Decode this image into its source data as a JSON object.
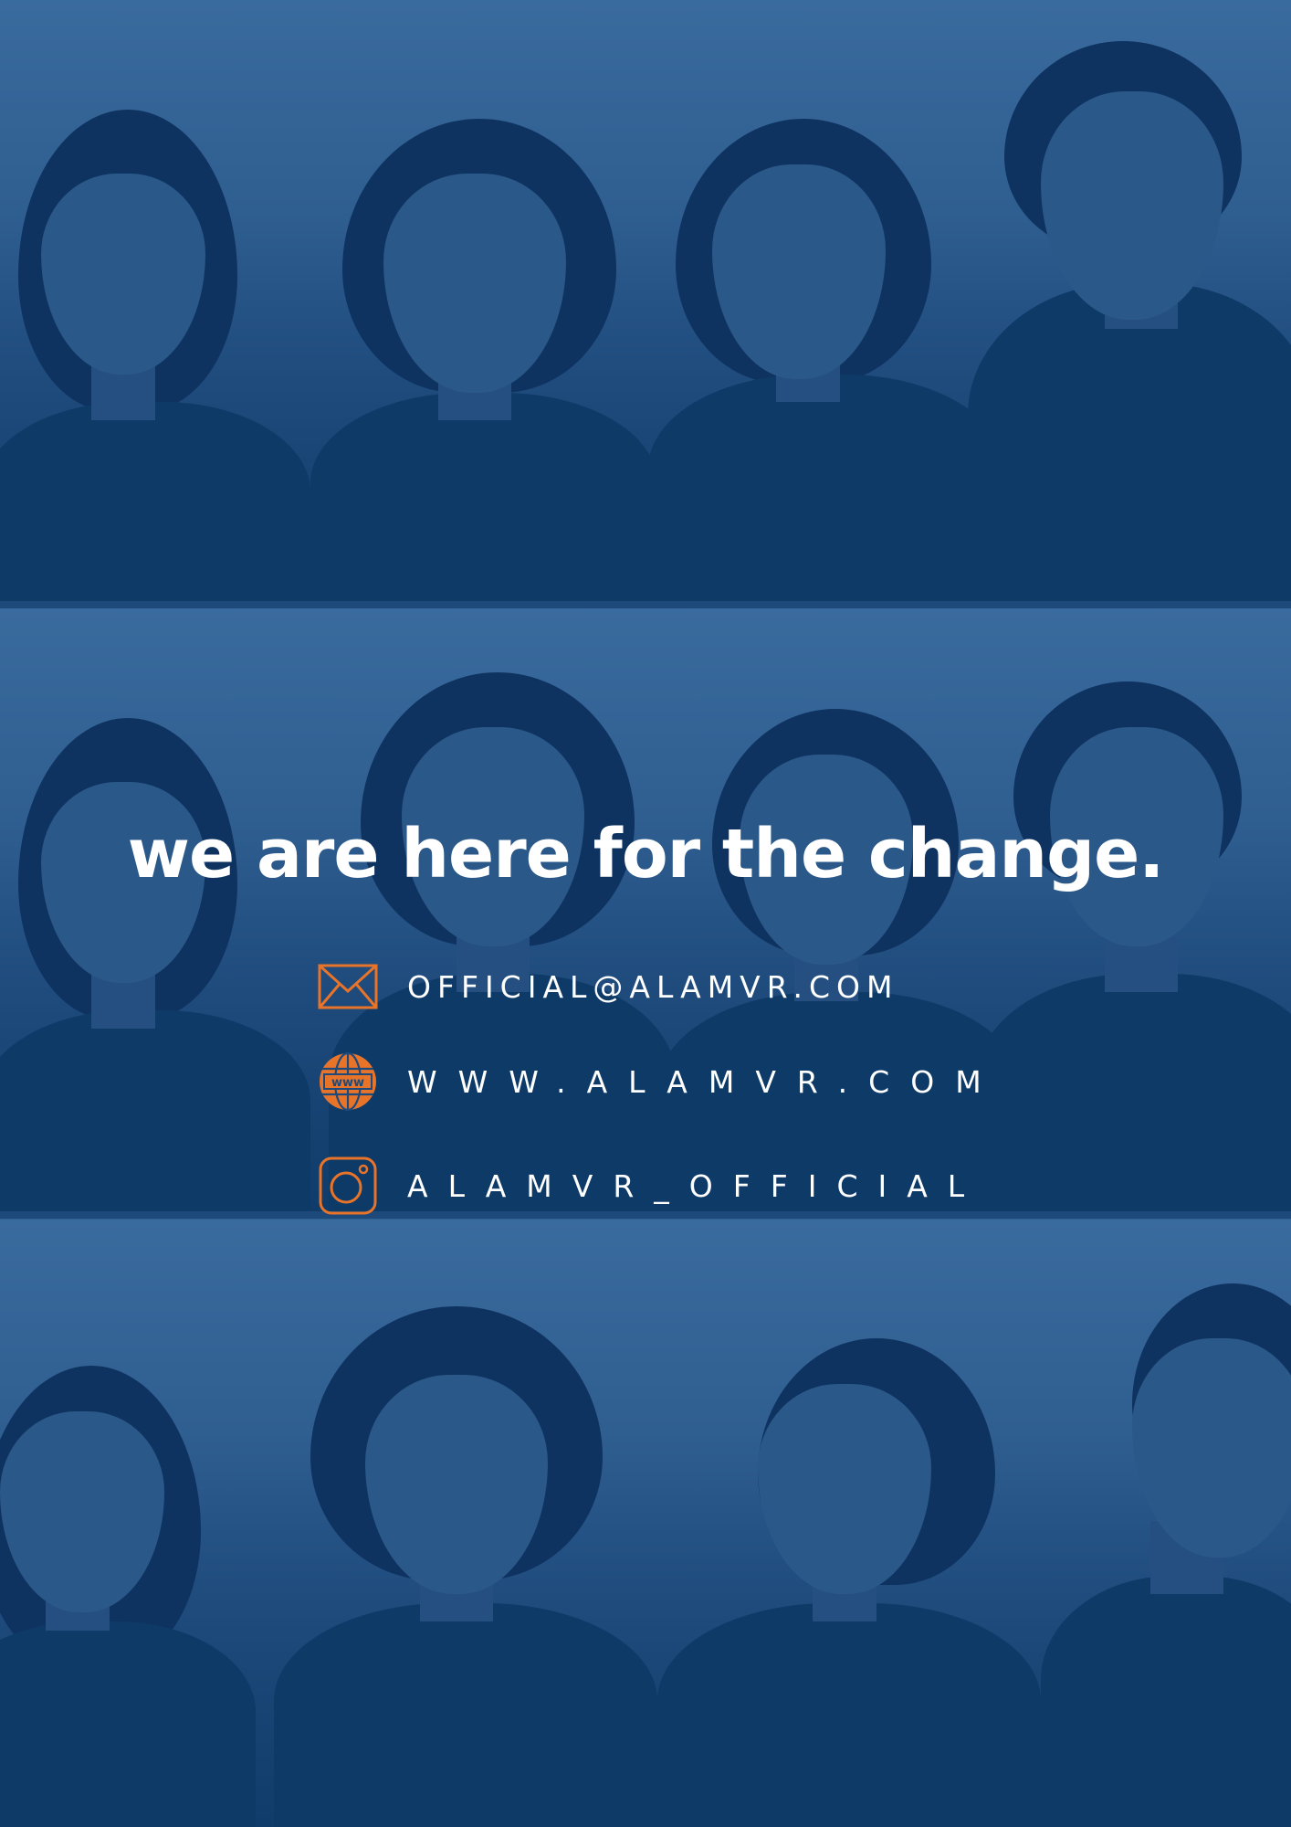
{
  "headline": "we are here for the change.",
  "contacts": {
    "email": {
      "text": "OFFICIAL@ALAMVR.COM",
      "icon": "envelope-icon"
    },
    "website": {
      "text": "WWW.ALAMVR.COM",
      "icon": "globe-www-icon",
      "badge": "www"
    },
    "instagram": {
      "text": "ALAMVR_OFFICIAL",
      "icon": "instagram-icon"
    }
  },
  "colors": {
    "background": "#2f6090",
    "text": "#ffffff",
    "icon_accent": "#e8742a"
  },
  "photos": {
    "rows": 3,
    "people_per_row": 4
  }
}
